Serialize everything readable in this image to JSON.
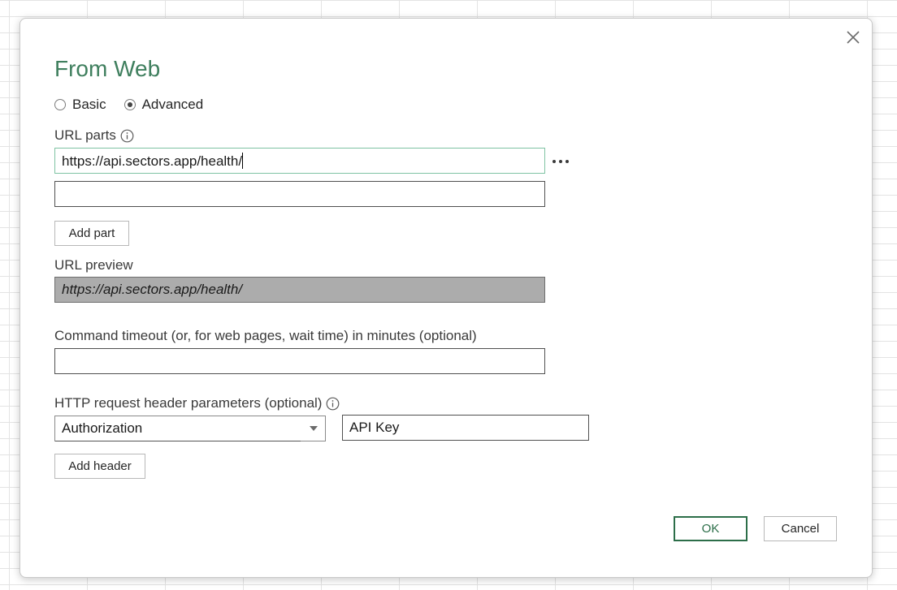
{
  "dialog": {
    "title": "From Web",
    "mode": {
      "options": [
        {
          "label": "Basic",
          "checked": false
        },
        {
          "label": "Advanced",
          "checked": true
        }
      ]
    },
    "url_parts": {
      "label": "URL parts",
      "icon": "info-icon",
      "values": [
        "https://api.sectors.app/health/",
        ""
      ],
      "more_icon": "ellipsis-icon",
      "add_label": "Add part"
    },
    "url_preview": {
      "label": "URL preview",
      "value": "https://api.sectors.app/health/"
    },
    "timeout": {
      "label": "Command timeout (or, for web pages, wait time) in minutes (optional)",
      "value": ""
    },
    "headers": {
      "label": "HTTP request header parameters (optional)",
      "icon": "info-icon",
      "name": "Authorization",
      "value": "API Key",
      "add_label": "Add header"
    },
    "buttons": {
      "ok": "OK",
      "cancel": "Cancel"
    },
    "close_icon": "close-icon"
  },
  "colors": {
    "title": "#3f7f5e",
    "primary_border": "#2c6e49",
    "focus_border": "#7fc3a3",
    "preview_bg": "#acacac"
  }
}
